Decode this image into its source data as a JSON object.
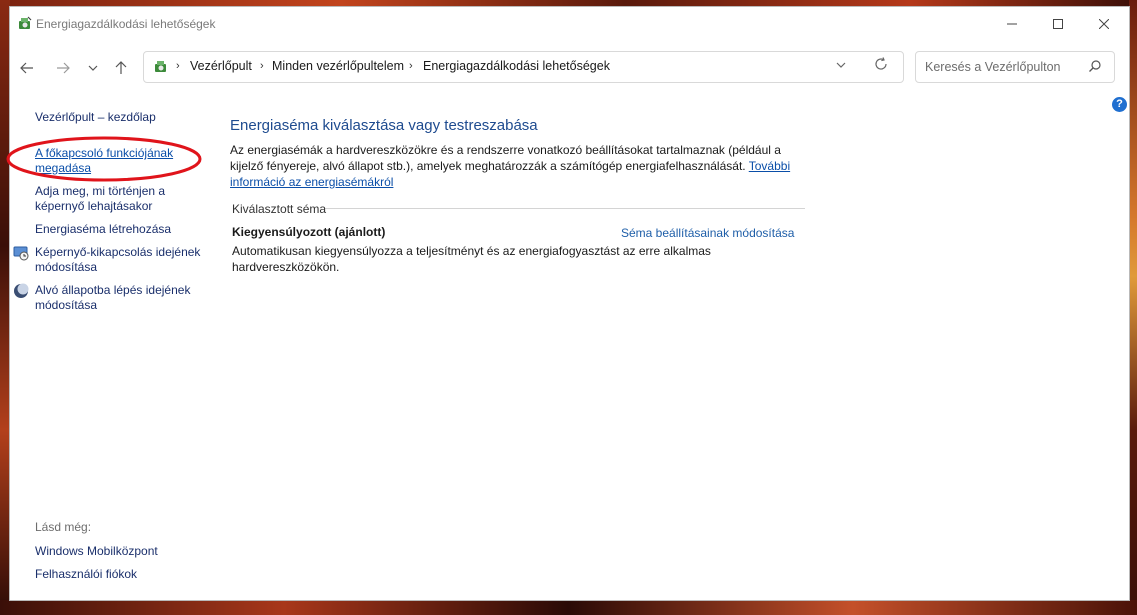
{
  "window": {
    "title": "Energiagazdálkodási lehetőségek"
  },
  "nav": {
    "breadcrumbs": [
      "Vezérlőpult",
      "Minden vezérlőpultelem",
      "Energiagazdálkodási lehetőségek"
    ],
    "search_placeholder": "Keresés a Vezérlőpulton"
  },
  "left_pane": {
    "home": "Vezérlőpult – kezdőlap",
    "power_button": "A főkapcsoló funkciójának megadása",
    "lid_close": "Adja meg, mi történjen a képernyő lehajtásakor",
    "create_plan": "Energiaséma létrehozása",
    "display_off": "Képernyő-kikapcsolás idejének módosítása",
    "sleep": "Alvó állapotba lépés idejének módosítása",
    "see_also_label": "Lásd még:",
    "see_also": [
      "Windows Mobilközpont",
      "Felhasználói fiókok"
    ]
  },
  "main": {
    "title": "Energiaséma kiválasztása vagy testreszabása",
    "description": "Az energiasémák a hardvereszközökre és a rendszerre vonatkozó beállításokat tartalmaznak (például a kijelző fényereje, alvó állapot stb.), amelyek meghatározzák a számítógép energiafelhasználását.",
    "more_info": "További információ az energiasémákról",
    "selected_label": "Kiválasztott séma",
    "plan_name": "Kiegyensúlyozott (ajánlott)",
    "plan_change": "Séma beállításainak módosítása",
    "plan_description": "Automatikusan kiegyensúlyozza a teljesítményt és az energiafogyasztást az erre alkalmas hardvereszközökön."
  },
  "colors": {
    "link": "#1a2f6b",
    "heading": "#1e4b8f",
    "highlight_ellipse": "#e0141b"
  },
  "icons": {
    "help": "?"
  }
}
